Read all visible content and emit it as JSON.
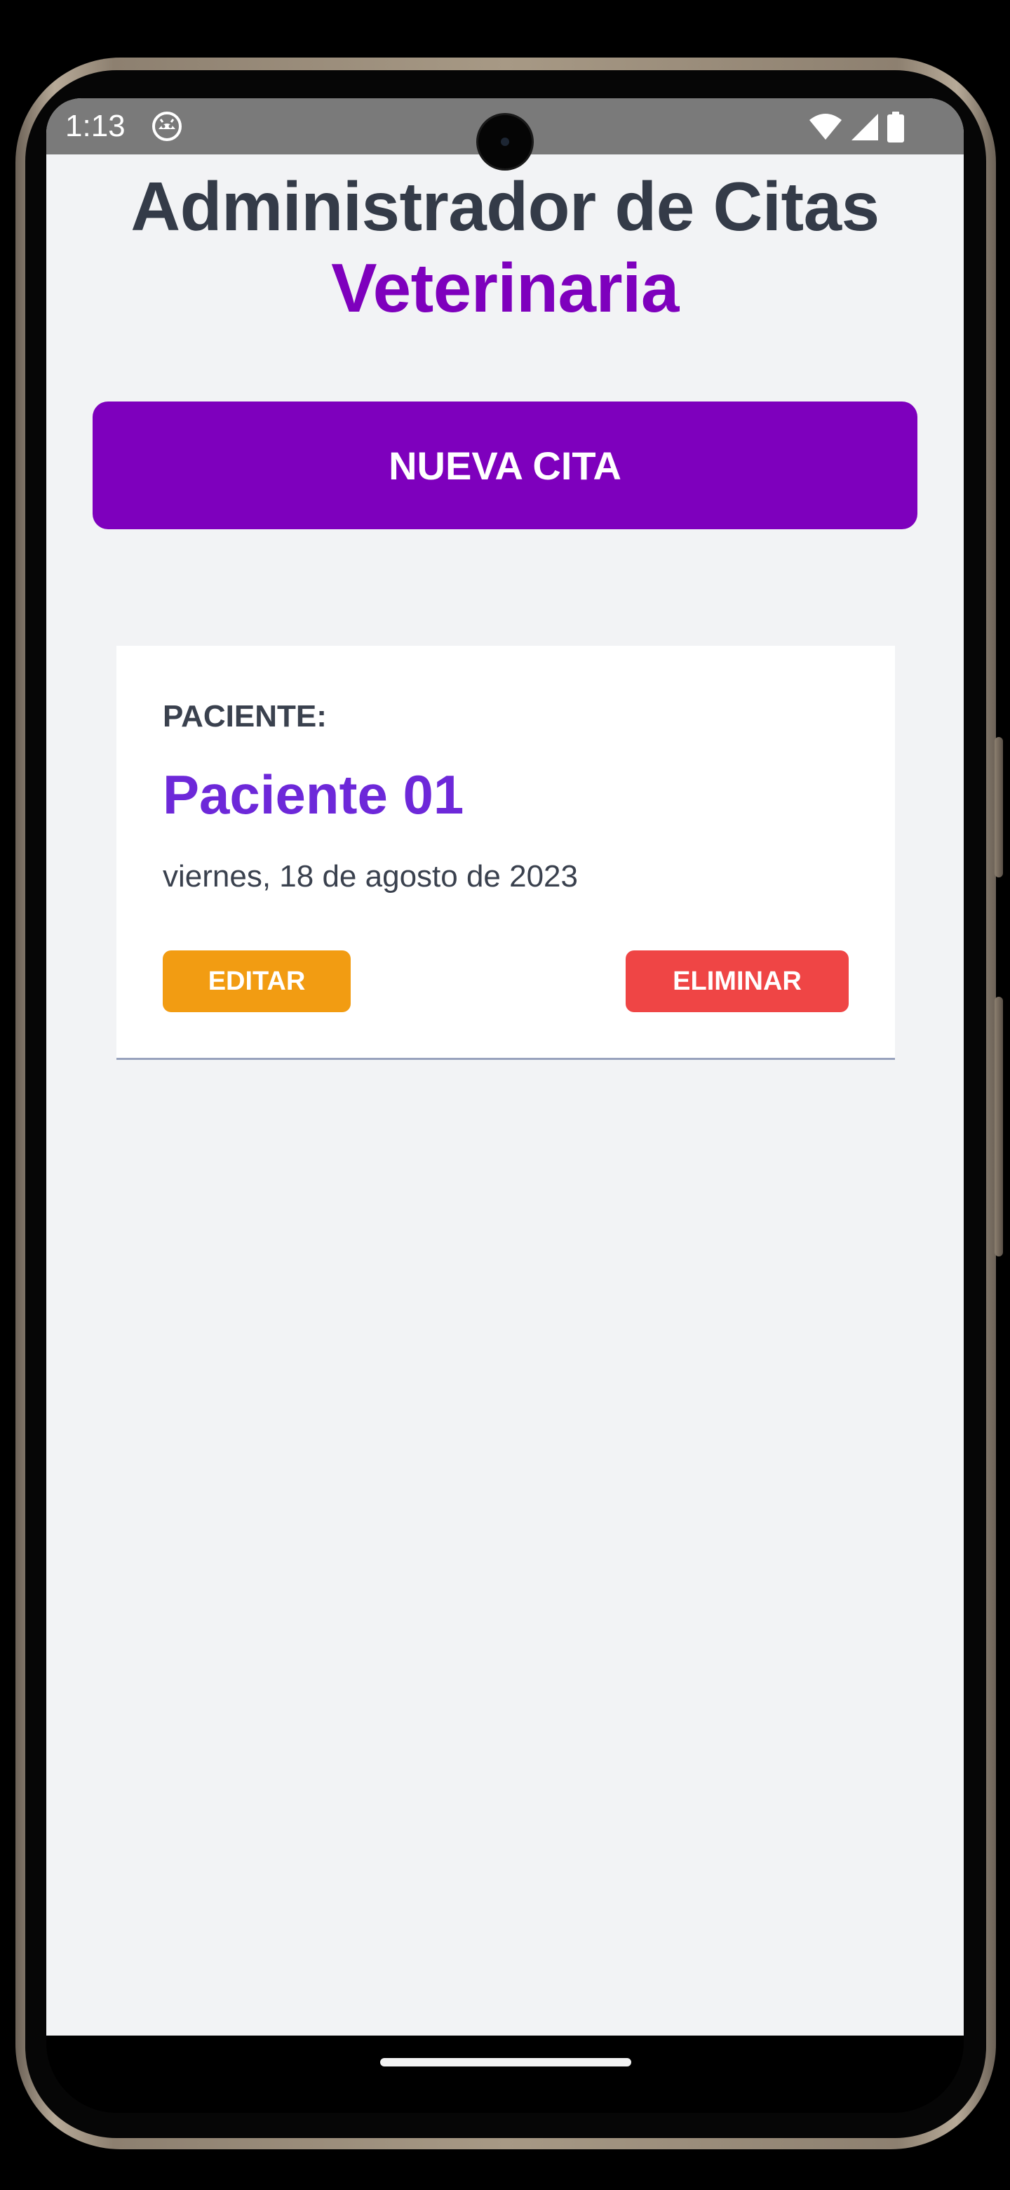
{
  "status_bar": {
    "time": "1:13",
    "app_icon": "android-face-icon",
    "wifi_icon": "wifi-icon",
    "signal_icon": "signal-icon",
    "battery_icon": "battery-icon"
  },
  "header": {
    "title_line1": "Administrador de Citas",
    "title_line2": "Veterinaria"
  },
  "new_appointment_button": {
    "label": "NUEVA CITA"
  },
  "appointments": [
    {
      "label": "PACIENTE:",
      "name": "Paciente 01",
      "date": "viernes, 18 de agosto de 2023",
      "edit_label": "EDITAR",
      "delete_label": "ELIMINAR"
    }
  ],
  "colors": {
    "brand_purple": "#7e00bd",
    "patient_name": "#6d28d9",
    "title_dark": "#343b48",
    "edit_button": "#f29c12",
    "delete_button": "#ef4545",
    "background": "#f2f3f5"
  }
}
